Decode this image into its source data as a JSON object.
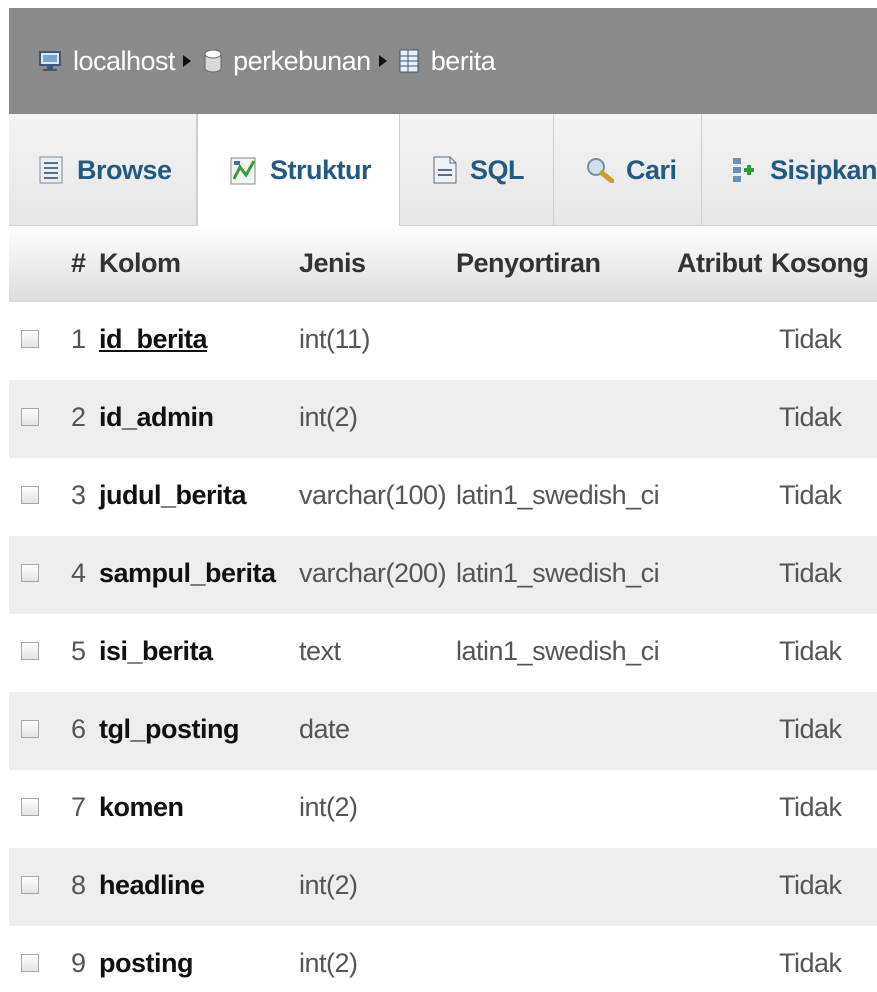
{
  "breadcrumb": {
    "server": "localhost",
    "database": "perkebunan",
    "table": "berita"
  },
  "tabs": [
    {
      "label": "Browse",
      "icon": "browse-icon"
    },
    {
      "label": "Struktur",
      "icon": "structure-icon",
      "active": true
    },
    {
      "label": "SQL",
      "icon": "sql-icon"
    },
    {
      "label": "Cari",
      "icon": "search-icon"
    },
    {
      "label": "Sisipkan",
      "icon": "insert-icon"
    }
  ],
  "table": {
    "headers": {
      "num": "#",
      "name": "Kolom",
      "type": "Jenis",
      "collation": "Penyortiran",
      "attributes": "Atribut",
      "null": "Kosong"
    },
    "rows": [
      {
        "num": "1",
        "name": "id_berita",
        "type": "int(11)",
        "collation": "",
        "null": "Tidak",
        "primary": true
      },
      {
        "num": "2",
        "name": "id_admin",
        "type": "int(2)",
        "collation": "",
        "null": "Tidak"
      },
      {
        "num": "3",
        "name": "judul_berita",
        "type": "varchar(100)",
        "collation": "latin1_swedish_ci",
        "null": "Tidak"
      },
      {
        "num": "4",
        "name": "sampul_berita",
        "type": "varchar(200)",
        "collation": "latin1_swedish_ci",
        "null": "Tidak"
      },
      {
        "num": "5",
        "name": "isi_berita",
        "type": "text",
        "collation": "latin1_swedish_ci",
        "null": "Tidak"
      },
      {
        "num": "6",
        "name": "tgl_posting",
        "type": "date",
        "collation": "",
        "null": "Tidak"
      },
      {
        "num": "7",
        "name": "komen",
        "type": "int(2)",
        "collation": "",
        "null": "Tidak"
      },
      {
        "num": "8",
        "name": "headline",
        "type": "int(2)",
        "collation": "",
        "null": "Tidak"
      },
      {
        "num": "9",
        "name": "posting",
        "type": "int(2)",
        "collation": "",
        "null": "Tidak"
      }
    ]
  },
  "colors": {
    "breadcrumb_bg": "#8a8a8a",
    "tab_text": "#235a81",
    "row_alt": "#eeeeee"
  }
}
